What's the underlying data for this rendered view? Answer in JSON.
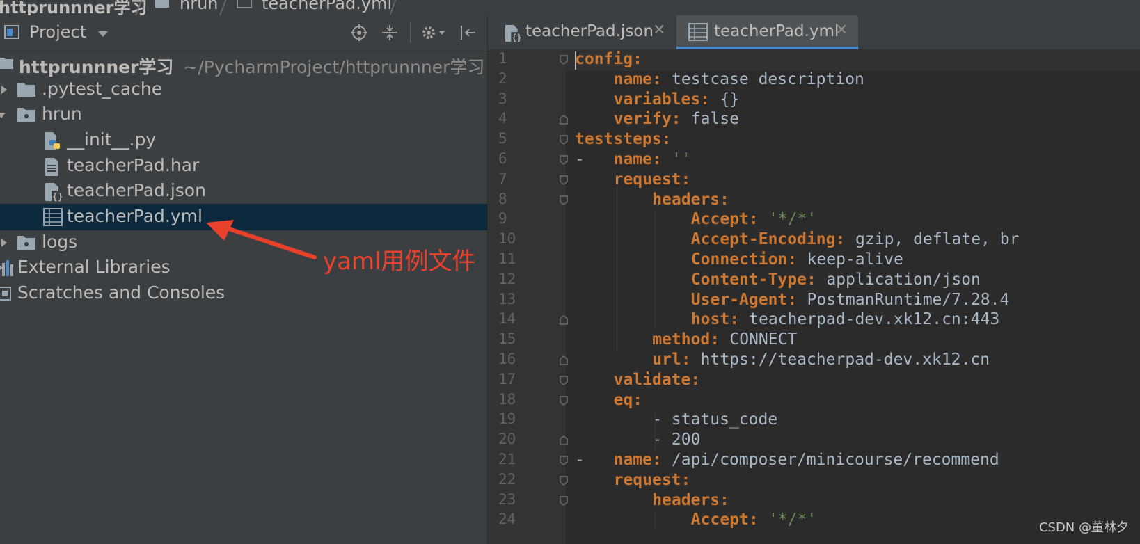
{
  "breadcrumb": {
    "items": [
      "httprunnner学习",
      "hrun",
      "teacherPad.yml"
    ]
  },
  "project_panel": {
    "title": "Project",
    "tree": [
      {
        "label": "httprunnner学习",
        "path": "~/PycharmProject/httprunnner学习",
        "kind": "root-folder"
      },
      {
        "label": ".pytest_cache",
        "kind": "folder",
        "collapsed": true
      },
      {
        "label": "hrun",
        "kind": "package",
        "collapsed": false
      },
      {
        "label": "__init__.py",
        "kind": "python-file"
      },
      {
        "label": "teacherPad.har",
        "kind": "text-file"
      },
      {
        "label": "teacherPad.json",
        "kind": "json-file"
      },
      {
        "label": "teacherPad.yml",
        "kind": "yaml-file",
        "selected": true
      },
      {
        "label": "logs",
        "kind": "folder",
        "collapsed": true
      },
      {
        "label": "External Libraries",
        "kind": "libraries"
      },
      {
        "label": "Scratches and Consoles",
        "kind": "scratches"
      }
    ],
    "annotation": "yaml用例文件"
  },
  "editor": {
    "tabs": [
      {
        "label": "teacherPad.json",
        "active": false
      },
      {
        "label": "teacherPad.yml",
        "active": true
      }
    ],
    "lines": [
      {
        "n": "1",
        "key": "config:",
        "val": ""
      },
      {
        "n": "2",
        "key": "name:",
        "val": " testcase description"
      },
      {
        "n": "3",
        "key": "variables:",
        "val": " {}"
      },
      {
        "n": "4",
        "key": "verify:",
        "val": " false"
      },
      {
        "n": "5",
        "key": "teststeps:",
        "val": ""
      },
      {
        "n": "6",
        "key": "name:",
        "val": " ''"
      },
      {
        "n": "7",
        "key": "request:",
        "val": ""
      },
      {
        "n": "8",
        "key": "headers:",
        "val": ""
      },
      {
        "n": "9",
        "key": "Accept:",
        "val": " '*/*'"
      },
      {
        "n": "10",
        "key": "Accept-Encoding:",
        "val": " gzip, deflate, br"
      },
      {
        "n": "11",
        "key": "Connection:",
        "val": " keep-alive"
      },
      {
        "n": "12",
        "key": "Content-Type:",
        "val": " application/json"
      },
      {
        "n": "13",
        "key": "User-Agent:",
        "val": " PostmanRuntime/7.28.4"
      },
      {
        "n": "14",
        "key": "host:",
        "val": " teacherpad-dev.xk12.cn:443"
      },
      {
        "n": "15",
        "key": "method:",
        "val": " CONNECT"
      },
      {
        "n": "16",
        "key": "url:",
        "val": " https://teacherpad-dev.xk12.cn"
      },
      {
        "n": "17",
        "key": "validate:",
        "val": ""
      },
      {
        "n": "18",
        "key": "eq:",
        "val": ""
      },
      {
        "n": "19",
        "key": "",
        "val": "- status_code"
      },
      {
        "n": "20",
        "key": "",
        "val": "- 200"
      },
      {
        "n": "21",
        "key": "name:",
        "val": " /api/composer/minicourse/recommend"
      },
      {
        "n": "22",
        "key": "request:",
        "val": ""
      },
      {
        "n": "23",
        "key": "headers:",
        "val": ""
      },
      {
        "n": "24",
        "key": "Accept:",
        "val": " '*/*'"
      }
    ]
  },
  "watermark": "CSDN @董林夕"
}
